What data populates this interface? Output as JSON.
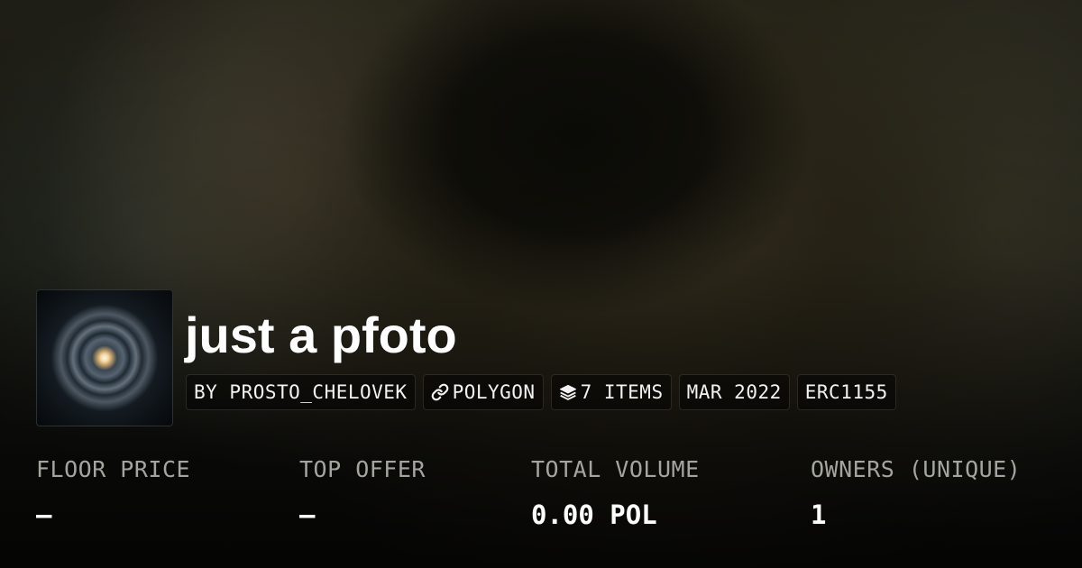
{
  "collection": {
    "name": "just a pfoto",
    "tags": [
      {
        "label": "BY PROSTO_CHELOVEK",
        "icon": ""
      },
      {
        "label": "POLYGON",
        "icon": "link-icon"
      },
      {
        "label": "7 ITEMS",
        "icon": "layers-icon"
      },
      {
        "label": "MAR 2022",
        "icon": ""
      },
      {
        "label": "ERC1155",
        "icon": ""
      }
    ]
  },
  "stats": [
    {
      "label": "FLOOR PRICE",
      "value": "—"
    },
    {
      "label": "TOP OFFER",
      "value": "—"
    },
    {
      "label": "TOTAL VOLUME",
      "value": "0.00 POL"
    },
    {
      "label": "OWNERS (UNIQUE)",
      "value": "1"
    }
  ],
  "colors": {
    "text_primary": "#ffffff",
    "text_secondary": "#a5a5a0",
    "tag_background": "#000000"
  }
}
